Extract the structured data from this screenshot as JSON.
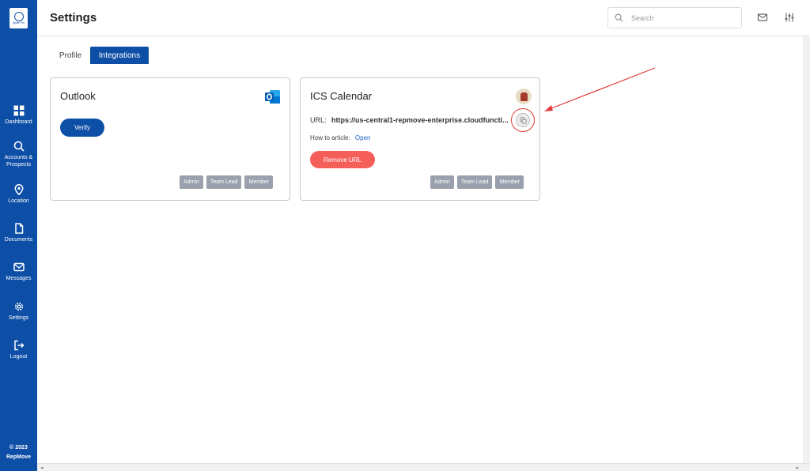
{
  "sidebar": {
    "logo_text": "Ignite Pro",
    "items": [
      {
        "label": "Dashboard",
        "icon": "dashboard-icon"
      },
      {
        "label": "Accounts & Prospects",
        "icon": "search-icon"
      },
      {
        "label": "Location",
        "icon": "location-pin-icon"
      },
      {
        "label": "Documents",
        "icon": "document-icon"
      },
      {
        "label": "Messages",
        "icon": "mail-icon"
      },
      {
        "label": "Settings",
        "icon": "gear-icon"
      },
      {
        "label": "Logout",
        "icon": "logout-icon"
      }
    ],
    "copyright_year": "© 2023",
    "copyright_brand": "RepMove"
  },
  "header": {
    "title": "Settings",
    "search_placeholder": "Search"
  },
  "tabs": [
    {
      "label": "Profile",
      "active": false
    },
    {
      "label": "Integrations",
      "active": true
    }
  ],
  "cards": {
    "outlook": {
      "title": "Outlook",
      "verify_label": "Verify",
      "roles": [
        "Admin",
        "Team Lead",
        "Member"
      ]
    },
    "ics": {
      "title": "ICS Calendar",
      "url_label": "URL:",
      "url_value": "https://us-central1-repmove-enterprise.cloudfuncti...",
      "howto_label": "How to article:",
      "howto_link": "Open",
      "remove_label": "Remove URL",
      "roles": [
        "Admin",
        "Team Lead",
        "Member"
      ]
    }
  },
  "colors": {
    "primary": "#0d4ea6",
    "danger": "#f55f5a",
    "annotation": "#e23b3b",
    "role_badge": "#9aa0ad"
  }
}
